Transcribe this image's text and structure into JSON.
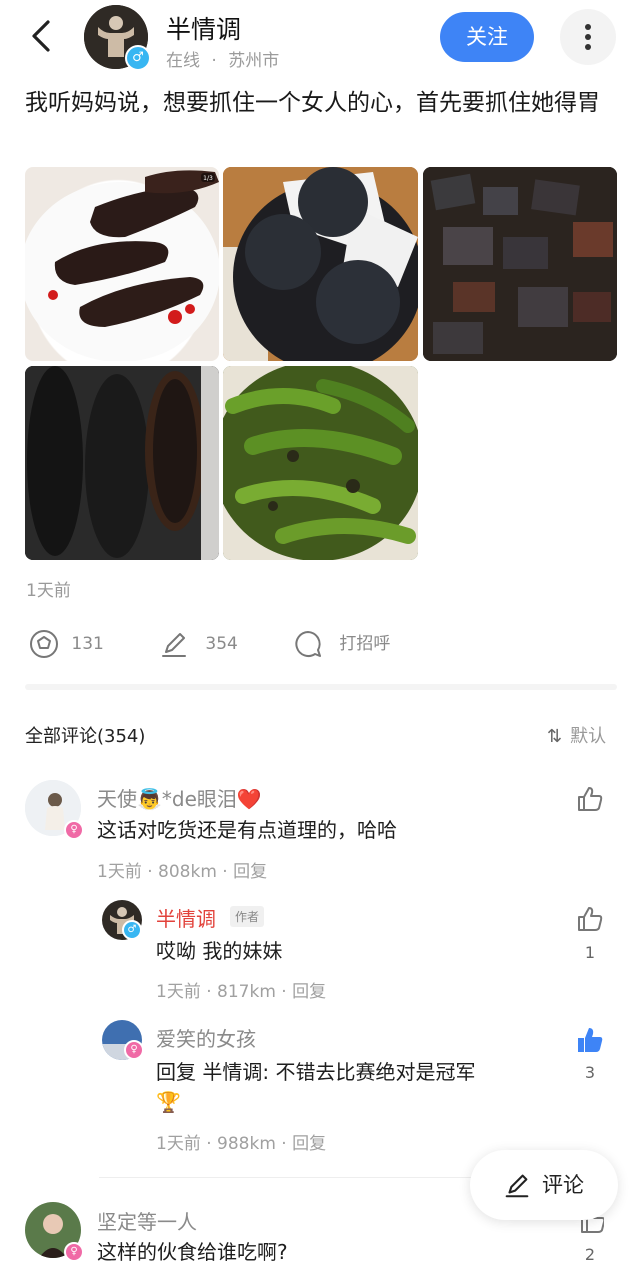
{
  "header": {
    "username": "半情调",
    "status": "在线",
    "dot": "·",
    "city": "苏州市",
    "follow_label": "关注"
  },
  "post": {
    "text": "我听妈妈说，想要抓住一个女人的心，首先要抓住她得胃",
    "photo1_badge": "1/3",
    "time": "1天前"
  },
  "actions": {
    "share_count": "131",
    "comment_count": "354",
    "greet_label": "打招呼"
  },
  "comments_header": {
    "title": "全部评论(354)",
    "sort_label": "默认",
    "sort_icon": "⇅"
  },
  "comments": [
    {
      "name": "天使👼*de眼泪❤️",
      "text": "这话对吃货还是有点道理的，哈哈",
      "meta": "1天前 · 808km · 回复"
    },
    {
      "name": "半情调",
      "author_tag": "作者",
      "text": "哎呦 我的妹妹",
      "meta": "1天前 · 817km · 回复",
      "likes": "1"
    },
    {
      "name": "爱笑的女孩",
      "text": "回复 半情调: 不错去比赛绝对是冠军",
      "trophy": "🏆",
      "meta": "1天前 · 988km · 回复",
      "likes": "3"
    },
    {
      "name": "坚定等一人",
      "text": "这样的伙食给谁吃啊?",
      "likes": "2"
    }
  ],
  "fab": {
    "label": "评论"
  },
  "colors": {
    "accent": "#3e84f6",
    "author": "#e2423b",
    "female_badge": "#f06aa6",
    "male_badge": "#38b6f2"
  }
}
